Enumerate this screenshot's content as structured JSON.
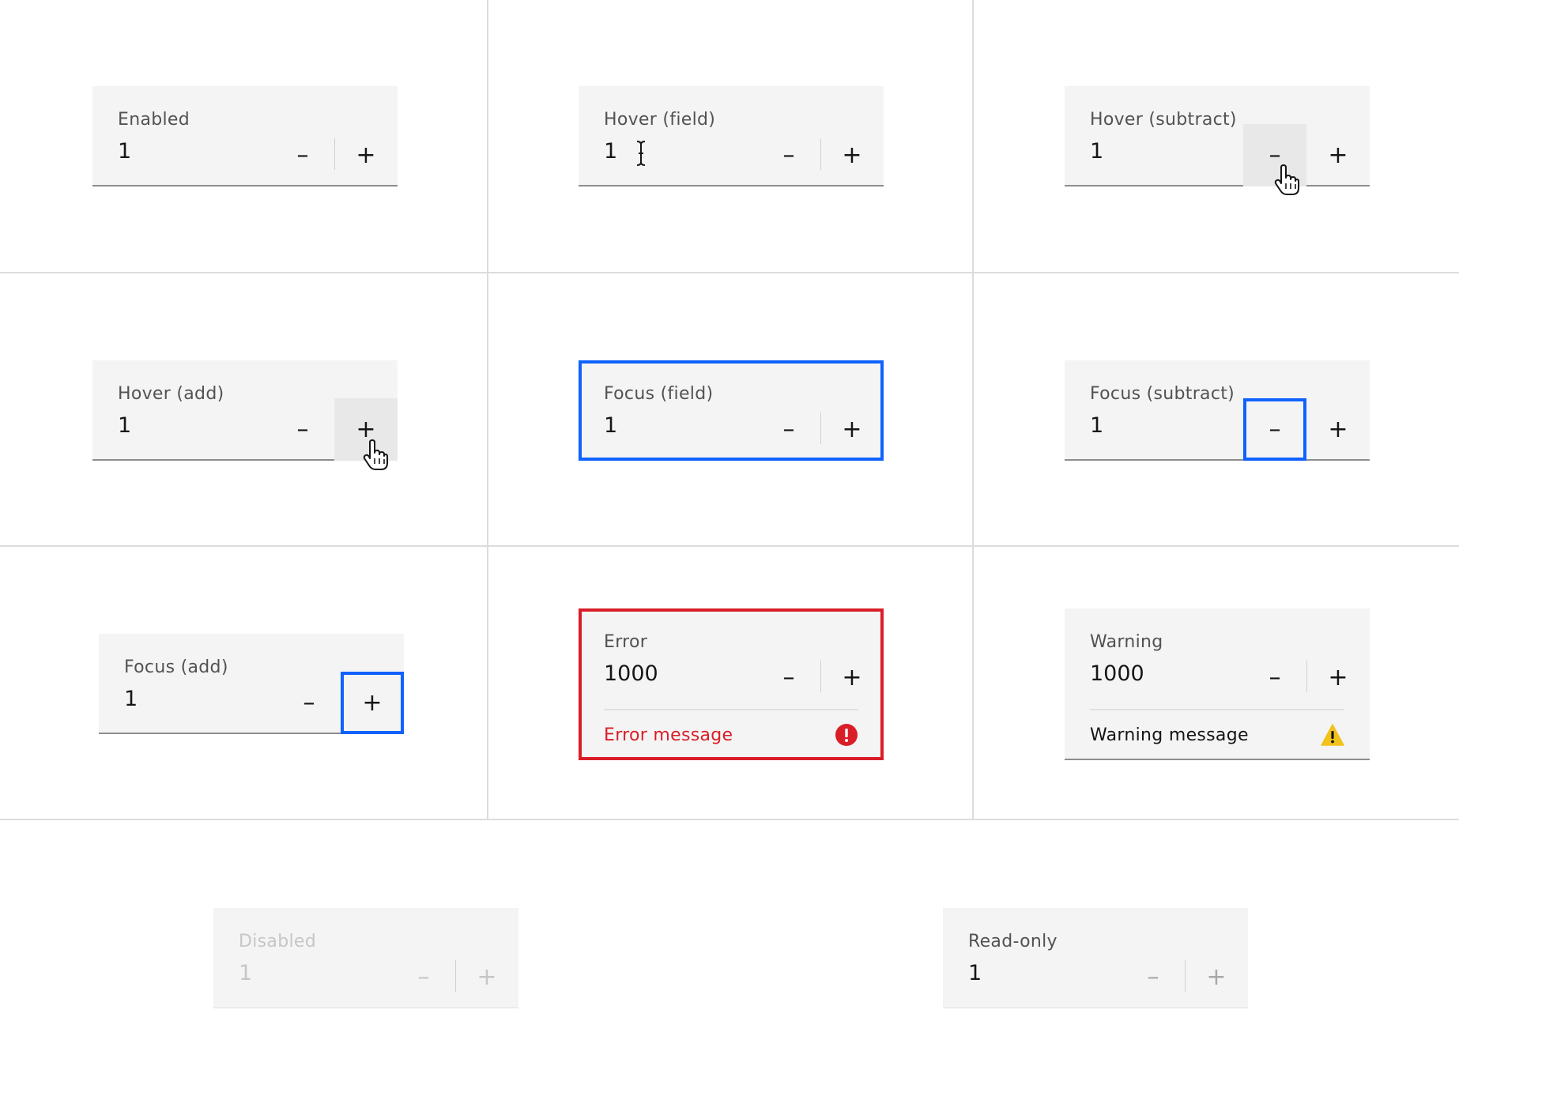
{
  "states": {
    "enabled": {
      "label": "Enabled",
      "value": "1"
    },
    "hover_field": {
      "label": "Hover (field)",
      "value": "1"
    },
    "hover_subtract": {
      "label": "Hover (subtract)",
      "value": "1"
    },
    "hover_add": {
      "label": "Hover (add)",
      "value": "1"
    },
    "focus_field": {
      "label": "Focus (field)",
      "value": "1"
    },
    "focus_subtract": {
      "label": "Focus (subtract)",
      "value": "1"
    },
    "focus_add": {
      "label": "Focus (add)",
      "value": "1"
    },
    "error": {
      "label": "Error",
      "value": "1000",
      "message": "Error message"
    },
    "warning": {
      "label": "Warning",
      "value": "1000",
      "message": "Warning message"
    },
    "disabled": {
      "label": "Disabled",
      "value": "1"
    },
    "readonly": {
      "label": "Read-only",
      "value": "1"
    }
  },
  "buttons": {
    "subtract": "–",
    "add": "+"
  },
  "icons": {
    "error": "error-filled-icon",
    "warning": "warning-alt-filled-icon",
    "hand_cursor": "hand-pointer-cursor-icon",
    "text_cursor": "i-beam-cursor-icon"
  },
  "colors": {
    "field_bg": "#f4f4f4",
    "focus": "#0f62fe",
    "error": "#da1e28",
    "warning": "#f1c21b",
    "hover": "#e8e8e8"
  }
}
